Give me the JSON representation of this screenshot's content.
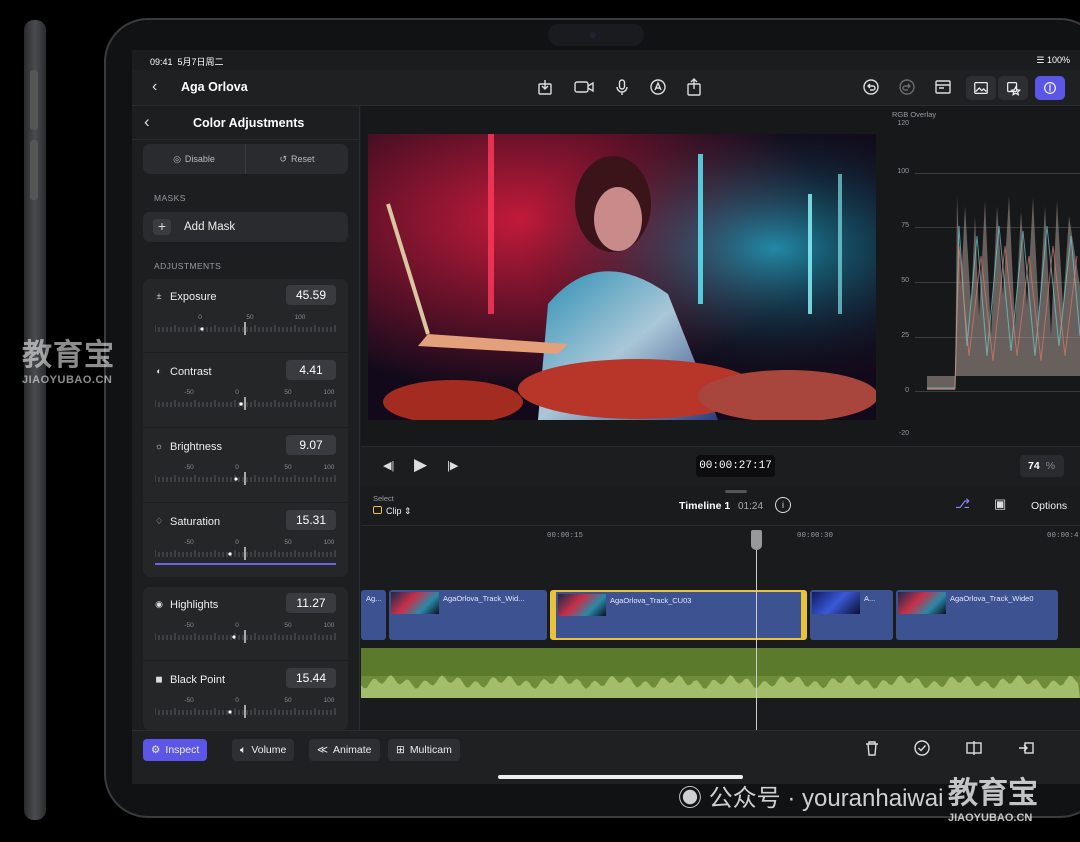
{
  "status": {
    "time": "09:41",
    "date": "5月7日周二",
    "battery": "100%"
  },
  "topbar": {
    "project_title": "Aga Orlova"
  },
  "inspector": {
    "title": "Color Adjustments",
    "disable_label": "Disable",
    "reset_label": "Reset",
    "masks_header": "MASKS",
    "add_mask_label": "Add Mask",
    "adjustments_header": "ADJUSTMENTS",
    "adjustments": [
      {
        "name": "Exposure",
        "icon": "exposure-icon",
        "value": "45.59",
        "ticks": [
          "0",
          "50",
          "100"
        ]
      },
      {
        "name": "Contrast",
        "icon": "contrast-icon",
        "value": "4.41",
        "ticks": [
          "-50",
          "0",
          "50",
          "100"
        ]
      },
      {
        "name": "Brightness",
        "icon": "brightness-icon",
        "value": "9.07",
        "ticks": [
          "-50",
          "0",
          "50",
          "100"
        ]
      },
      {
        "name": "Saturation",
        "icon": "saturation-icon",
        "value": "15.31",
        "ticks": [
          "-50",
          "0",
          "50",
          "100"
        ]
      },
      {
        "name": "Highlights",
        "icon": "highlights-icon",
        "value": "11.27",
        "ticks": [
          "-50",
          "0",
          "50",
          "100"
        ]
      },
      {
        "name": "Black Point",
        "icon": "black-point-icon",
        "value": "15.44",
        "ticks": [
          "-50",
          "0",
          "50",
          "100"
        ]
      }
    ]
  },
  "scope": {
    "title": "RGB Overlay",
    "labels": [
      "120",
      "100",
      "75",
      "50",
      "25",
      "0",
      "-20"
    ]
  },
  "viewer": {
    "timecode": "00:00:27:17",
    "zoom": "74",
    "zoom_unit": "%"
  },
  "timeline": {
    "select_label": "Select",
    "clip_label": "Clip",
    "name": "Timeline 1",
    "duration": "01:24",
    "options_label": "Options",
    "ruler": [
      "00:00:15",
      "00:00:30",
      "00:00:4"
    ],
    "clips": [
      "Ag...",
      "AgaOrlova_Track_Wid...",
      "AgaOrlova_Track_CU03",
      "A...",
      "AgaOrlova_Track_Wide0"
    ]
  },
  "bottom": {
    "inspect": "Inspect",
    "volume": "Volume",
    "animate": "Animate",
    "multicam": "Multicam"
  },
  "watermarks": {
    "cn": "教育宝",
    "en": "JIAOYUBAO.CN",
    "wechat": "公众号 · youranhaiwai"
  },
  "colors": {
    "accent": "#5b55e8",
    "clip": "#3d5290",
    "audio": "#6f8c3a",
    "selected": "#e8c23a"
  }
}
